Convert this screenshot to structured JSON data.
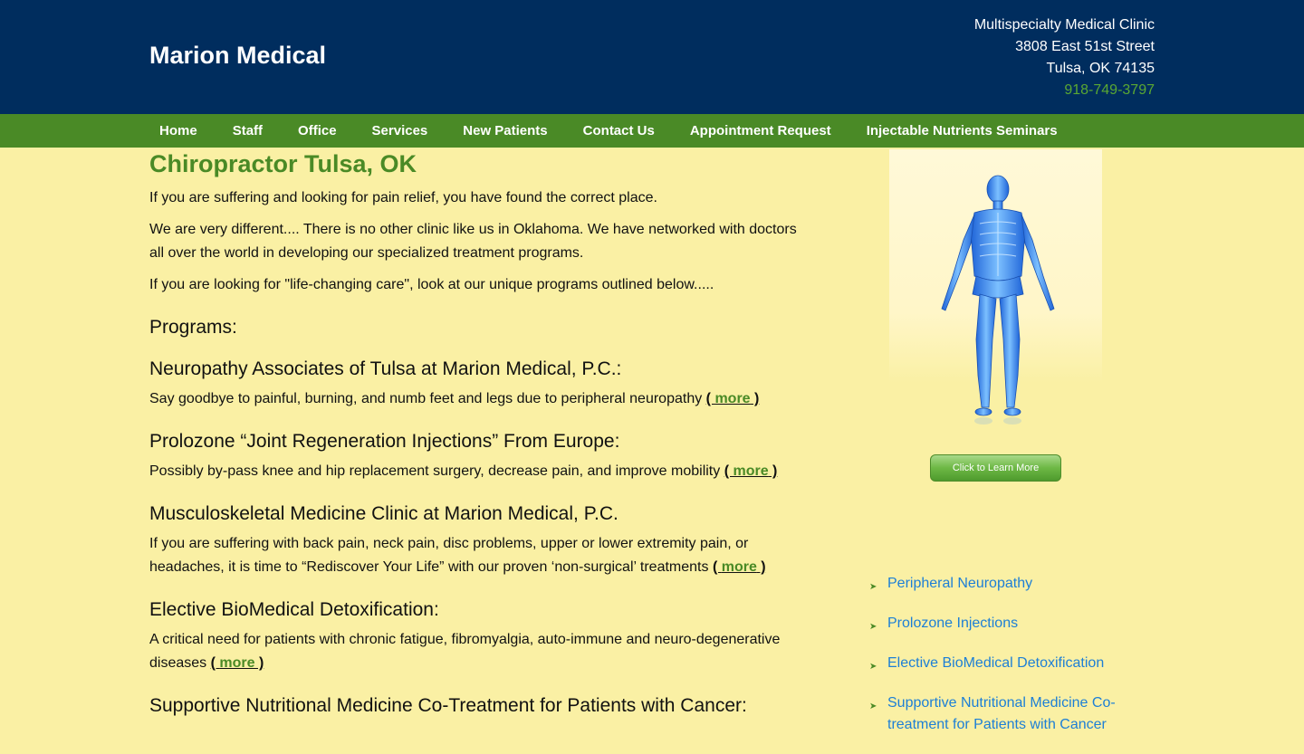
{
  "header": {
    "site_title": "Marion Medical",
    "address_line1": "Multispecialty Medical Clinic",
    "address_line2": "3808 East 51st Street",
    "address_line3": "Tulsa, OK 74135",
    "phone": "918-749-3797"
  },
  "nav": {
    "items": [
      {
        "label": "Home"
      },
      {
        "label": "Staff"
      },
      {
        "label": "Office"
      },
      {
        "label": "Services"
      },
      {
        "label": "New Patients"
      },
      {
        "label": "Contact Us"
      },
      {
        "label": "Appointment Request"
      },
      {
        "label": "Injectable Nutrients Seminars"
      }
    ]
  },
  "main": {
    "title": "Chiropractor Tulsa, OK",
    "intro": [
      "If you are suffering and looking for pain relief, you have found the correct place.",
      "We are very different....  There is no other clinic like us in Oklahoma.  We have networked with doctors all over the world in developing our specialized treatment programs.",
      "If you are looking for \"life-changing care\", look at our unique programs outlined below....."
    ],
    "programs_heading": "Programs:",
    "programs": [
      {
        "title": "Neuropathy Associates of Tulsa at Marion Medical, P.C.:",
        "desc": "Say goodbye to painful, burning, and numb feet and legs due to peripheral neuropathy "
      },
      {
        "title": "Prolozone “Joint Regeneration Injections” From Europe:",
        "desc": "Possibly by-pass knee and hip replacement surgery, decrease pain, and improve mobility "
      },
      {
        "title": "Musculoskeletal Medicine Clinic at Marion Medical, P.C.",
        "desc": "If you are suffering with back pain, neck pain, disc problems, upper or lower extremity pain, or headaches, it is time to “Rediscover Your Life” with our proven ‘non-surgical’ treatments "
      },
      {
        "title": "Elective BioMedical Detoxification:",
        "desc": "A critical need for patients with chronic fatigue, fibromyalgia, auto-immune and neuro-degenerative diseases "
      },
      {
        "title": "Supportive Nutritional Medicine Co-Treatment for Patients with Cancer:",
        "desc": ""
      }
    ],
    "more_open": "( ",
    "more_word": "more",
    "more_close": " )"
  },
  "sidebar": {
    "learn_button": "Click to Learn More",
    "links": [
      {
        "label": "Peripheral Neuropathy"
      },
      {
        "label": "Prolozone Injections"
      },
      {
        "label": "Elective BioMedical Detoxification"
      },
      {
        "label": "Supportive Nutritional Medicine Co-treatment for Patients with Cancer"
      }
    ]
  },
  "colors": {
    "header_bg": "#002d5e",
    "nav_bg": "#4a8a26",
    "page_bg": "#faf0a4",
    "title_green": "#4a8a26",
    "link_blue": "#1d7fd6",
    "phone_green": "#5aa832"
  },
  "icons": {
    "sidebar_bullet": "chevron-right-icon",
    "figure": "skeleton-figure-icon"
  }
}
